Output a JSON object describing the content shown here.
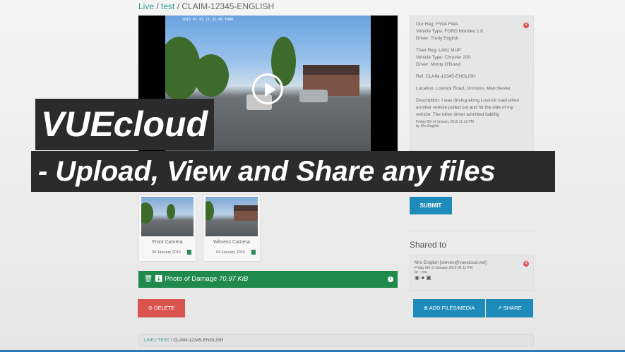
{
  "breadcrumb_top": {
    "live": "Live",
    "sep1": " / ",
    "test": "test",
    "sep2": " / ",
    "current": "CLAIM-12345-ENGLISH"
  },
  "video": {
    "hud_text": "2015 01 03  11:32:40  FORD"
  },
  "claim_info": {
    "our_reg": "Our Reg: FY04 FWA",
    "our_vehicle": "Vehicle Type: FORD Mondeo 1.8",
    "our_driver": "Driver: Trudy English",
    "their_reg": "Their Reg: LA61 MUP",
    "their_vehicle": "Vehicle Type: Chrysler 200",
    "their_driver": "Driver: Monty O'Dowd",
    "ref": "Ref: CLAIM-12345-ENGLISH",
    "location": "Location: Lostock Road, Urmston, Manchester.",
    "description": "Description: I was driving along Lostock road when another vehicle pulled out and hit the side of my vehicle. The other driver admitted liability.",
    "timestamp": "Friday 8th of January 2016 11:32 PM",
    "by": "by Mrs English"
  },
  "overlay": {
    "title": "VUEcloud",
    "subtitle": "- Upload, View and Share any files"
  },
  "submit_label": "SUBMIT",
  "shared": {
    "heading": "Shared to",
    "entry": "Mrs English [steven@vuecloud.net]",
    "timestamp": "Friday 8th of January 2016 08:11 PM",
    "by": "by - you"
  },
  "media": [
    {
      "label": "Front Camera",
      "date": "04 January 2016"
    },
    {
      "label": "Witness Camera",
      "date": "04 January 2016"
    }
  ],
  "attachment": {
    "name": "Photo of Damage",
    "size": "70.97 KiB"
  },
  "buttons": {
    "delete": "DELETE",
    "add_files": "ADD FILES/MEDIA",
    "share": "SHARE"
  },
  "breadcrumb_bottom": {
    "live": "LIVE",
    "test": "TEST",
    "current": "CLAIM-12345-ENGLISH"
  },
  "colors": {
    "primary": "#1f8bbb",
    "success": "#1f8a4c",
    "danger": "#d9534f",
    "link": "#2a9d8f"
  }
}
